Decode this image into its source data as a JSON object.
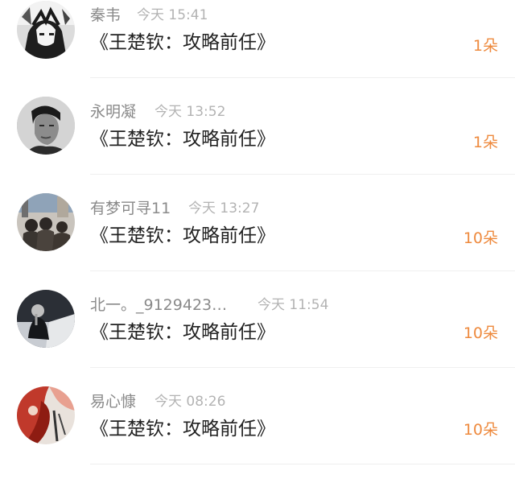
{
  "items": [
    {
      "avatar_icon": "avatar-anime-portrait-bw",
      "username": "秦韦",
      "time": "今天 15:41",
      "message": "《王楚钦：攻略前任》",
      "gift": "1朵"
    },
    {
      "avatar_icon": "avatar-man-portrait-bw",
      "username": "永明凝",
      "time": "今天 13:52",
      "message": "《王楚钦：攻略前任》",
      "gift": "1朵"
    },
    {
      "avatar_icon": "avatar-group-scene",
      "username": "有梦可寻11",
      "time": "今天 13:27",
      "message": "《王楚钦：攻略前任》",
      "gift": "10朵"
    },
    {
      "avatar_icon": "avatar-dark-figure",
      "username": "北一。_9129423…",
      "time": "今天 11:54",
      "message": "《王楚钦：攻略前任》",
      "gift": "10朵"
    },
    {
      "avatar_icon": "avatar-red-art",
      "username": "易心慷",
      "time": "今天 08:26",
      "message": "《王楚钦：攻略前任》",
      "gift": "10朵"
    }
  ],
  "colors": {
    "username": "#8a8a8a",
    "time": "#b3b3b3",
    "message": "#222222",
    "gift": "#ee8a3e",
    "divider": "#efefef"
  }
}
